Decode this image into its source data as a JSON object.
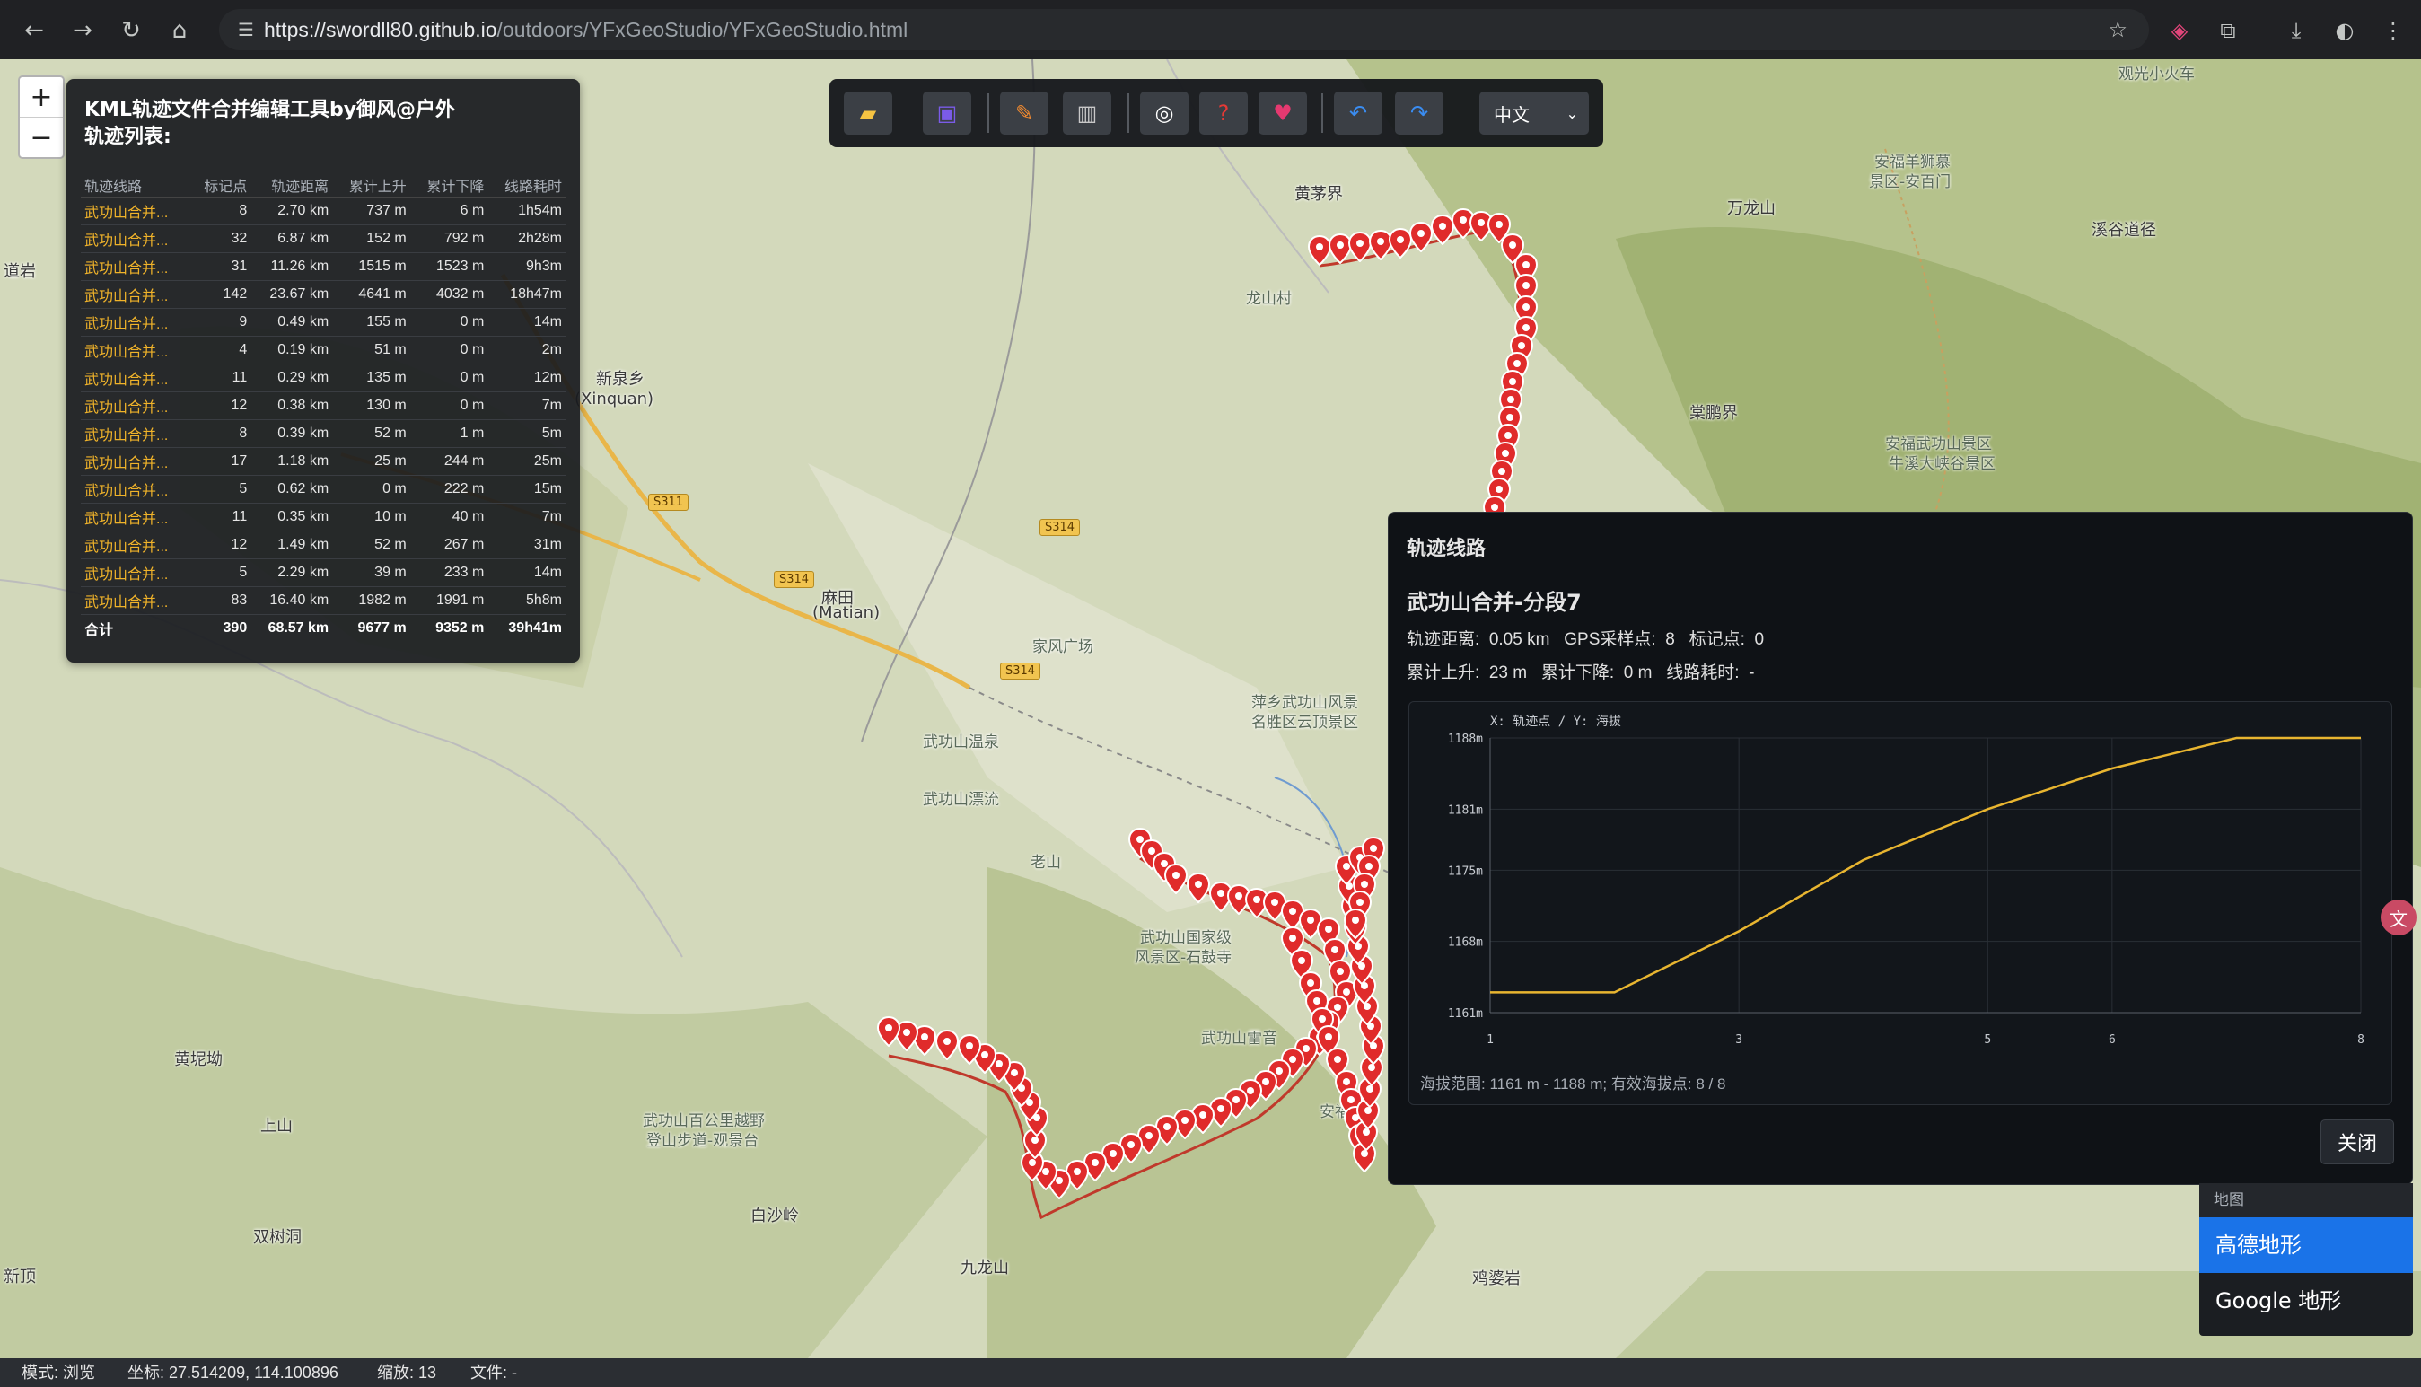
{
  "browser": {
    "url_host": "https://swordll80.github.io",
    "url_path": "/outdoors/YFxGeoStudio/YFxGeoStudio.html"
  },
  "map": {
    "places": [
      {
        "name": "新泉乡",
        "id": "p1"
      },
      {
        "name": "(Xinquan)",
        "id": "p2"
      },
      {
        "name": "麻田",
        "id": "p3"
      },
      {
        "name": "(Matian)",
        "id": "p4"
      },
      {
        "name": "黄茅界",
        "id": "p5"
      },
      {
        "name": "龙山村",
        "id": "p6"
      },
      {
        "name": "万龙山",
        "id": "p7"
      },
      {
        "name": "安福羊狮慕",
        "id": "p8"
      },
      {
        "name": "景区-安百门",
        "id": "p9"
      },
      {
        "name": "溪谷道径",
        "id": "p10"
      },
      {
        "name": "观光小火车",
        "id": "p11"
      },
      {
        "name": "棠鹏界",
        "id": "p12"
      },
      {
        "name": "安福武功山景区",
        "id": "p13"
      },
      {
        "name": "牛溪大峡谷景区",
        "id": "p14"
      },
      {
        "name": "武功山温泉",
        "id": "p15"
      },
      {
        "name": "武功山漂流",
        "id": "p16"
      },
      {
        "name": "家风广场",
        "id": "p17"
      },
      {
        "name": "萍乡武功山风景",
        "id": "p18"
      },
      {
        "name": "名胜区云顶景区",
        "id": "p19"
      },
      {
        "name": "武功山国家级",
        "id": "p20"
      },
      {
        "name": "风景区-石鼓寺",
        "id": "p21"
      },
      {
        "name": "武功山雷音",
        "id": "p22"
      },
      {
        "name": "武功山百公里越野",
        "id": "p23"
      },
      {
        "name": "登山步道-观景台",
        "id": "p24"
      },
      {
        "name": "黄坭坳",
        "id": "p25"
      },
      {
        "name": "上山",
        "id": "p26"
      },
      {
        "name": "双树洞",
        "id": "p27"
      },
      {
        "name": "新顶",
        "id": "p28"
      },
      {
        "name": "白沙岭",
        "id": "p29"
      },
      {
        "name": "九龙山",
        "id": "p30"
      },
      {
        "name": "鸡婆岩",
        "id": "p31"
      },
      {
        "name": "安福武",
        "id": "p32"
      },
      {
        "name": "道岩",
        "id": "p33"
      },
      {
        "name": "老山",
        "id": "p34"
      }
    ],
    "roads": [
      "S314",
      "S314",
      "S314",
      "S311"
    ]
  },
  "zoom": {
    "in": "+",
    "out": "−"
  },
  "track_panel": {
    "title": "KML轨迹文件合并编辑工具by御风@户外",
    "subtitle": "轨迹列表:",
    "columns": [
      "轨迹线路",
      "标记点",
      "轨迹距离",
      "累计上升",
      "累计下降",
      "线路耗时"
    ],
    "rows": [
      [
        "武功山合并...",
        "8",
        "2.70 km",
        "737 m",
        "6 m",
        "1h54m"
      ],
      [
        "武功山合并...",
        "32",
        "6.87 km",
        "152 m",
        "792 m",
        "2h28m"
      ],
      [
        "武功山合并...",
        "31",
        "11.26 km",
        "1515 m",
        "1523 m",
        "9h3m"
      ],
      [
        "武功山合并...",
        "142",
        "23.67 km",
        "4641 m",
        "4032 m",
        "18h47m"
      ],
      [
        "武功山合并...",
        "9",
        "0.49 km",
        "155 m",
        "0 m",
        "14m"
      ],
      [
        "武功山合并...",
        "4",
        "0.19 km",
        "51 m",
        "0 m",
        "2m"
      ],
      [
        "武功山合并...",
        "11",
        "0.29 km",
        "135 m",
        "0 m",
        "12m"
      ],
      [
        "武功山合并...",
        "12",
        "0.38 km",
        "130 m",
        "0 m",
        "7m"
      ],
      [
        "武功山合并...",
        "8",
        "0.39 km",
        "52 m",
        "1 m",
        "5m"
      ],
      [
        "武功山合并...",
        "17",
        "1.18 km",
        "25 m",
        "244 m",
        "25m"
      ],
      [
        "武功山合并...",
        "5",
        "0.62 km",
        "0 m",
        "222 m",
        "15m"
      ],
      [
        "武功山合并...",
        "11",
        "0.35 km",
        "10 m",
        "40 m",
        "7m"
      ],
      [
        "武功山合并...",
        "12",
        "1.49 km",
        "52 m",
        "267 m",
        "31m"
      ],
      [
        "武功山合并...",
        "5",
        "2.29 km",
        "39 m",
        "233 m",
        "14m"
      ],
      [
        "武功山合并...",
        "83",
        "16.40 km",
        "1982 m",
        "1991 m",
        "5h8m"
      ]
    ],
    "total": [
      "合计",
      "390",
      "68.57 km",
      "9677 m",
      "9352 m",
      "39h41m"
    ]
  },
  "toolbar": {
    "language": "中文",
    "buttons": [
      "folder-icon",
      "save-icon",
      "pencil-icon",
      "trash-icon",
      "target-icon",
      "help-icon",
      "heart-icon",
      "undo-icon",
      "redo-icon"
    ]
  },
  "detail": {
    "header": "轨迹线路",
    "name": "武功山合并-分段7",
    "line1": "轨迹距离:  0.05 km   GPS采样点:  8   标记点:  0",
    "line2": "累计上升:  23 m   累计下降:  0 m   线路耗时:  -",
    "summary": "海拔范围:  1161 m - 1188 m;  有效海拔点:  8 / 8",
    "close": "关闭"
  },
  "chart_data": {
    "type": "line",
    "title": "X: 轨迹点 / Y: 海拔",
    "x": [
      1,
      2,
      3,
      4,
      5,
      6,
      7,
      8
    ],
    "x_ticks": [
      "1",
      "3",
      "5",
      "6",
      "8"
    ],
    "y_ticks": [
      "1188m",
      "1181m",
      "1175m",
      "1168m",
      "1161m"
    ],
    "ylim": [
      1161,
      1188
    ],
    "series": [
      {
        "name": "",
        "values": [
          1163,
          1163,
          1169,
          1176,
          1181,
          1185,
          1188,
          1188
        ],
        "color": "#e8b530"
      }
    ]
  },
  "layers": {
    "header": "地图",
    "options": [
      "高德地形",
      "Google 地形"
    ],
    "selected": 0
  },
  "status": {
    "mode": "模式: 浏览",
    "coord": "坐标: 27.514209, 114.100896",
    "zoom": "缩放: 13",
    "file": "文件: -"
  }
}
